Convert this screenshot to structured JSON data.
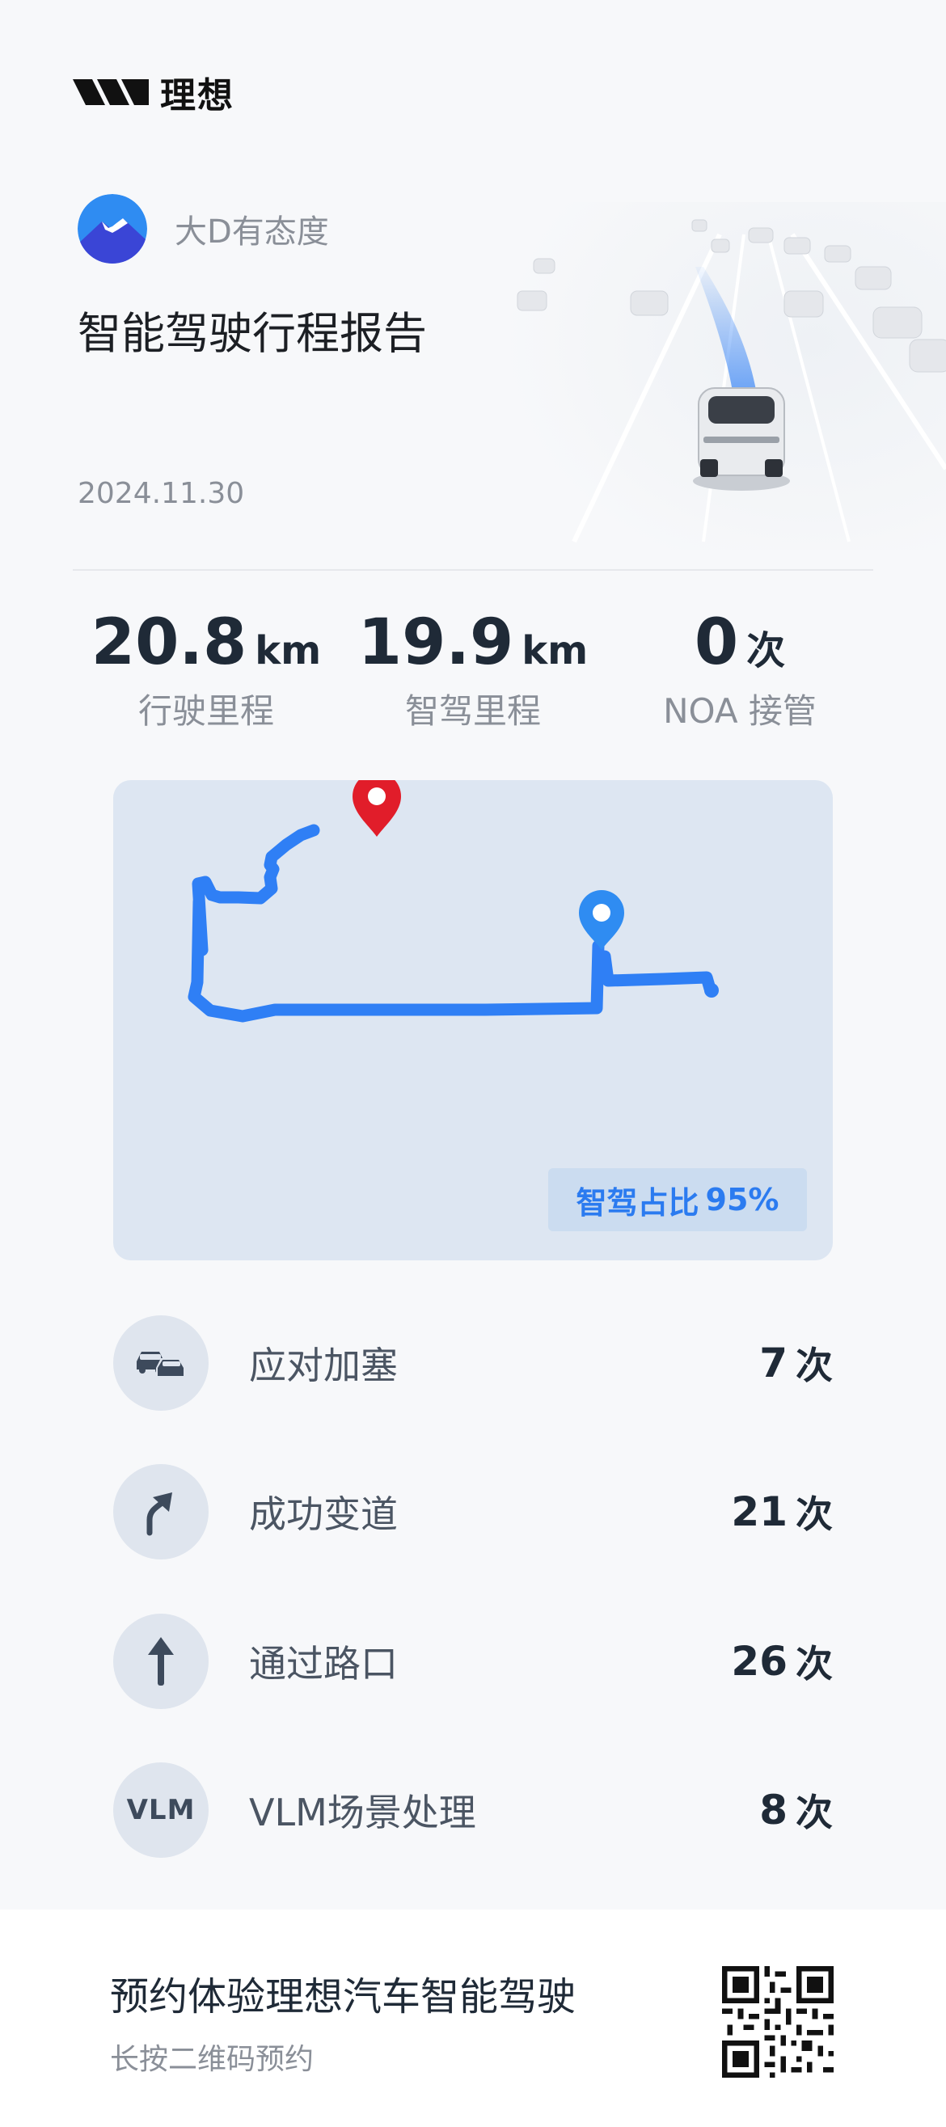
{
  "brand": {
    "name": "理想"
  },
  "user": {
    "name": "大D有态度"
  },
  "report": {
    "title": "智能驾驶行程报告",
    "date": "2024.11.30"
  },
  "stats": [
    {
      "value": "20.8",
      "unit": "km",
      "label": "行驶里程"
    },
    {
      "value": "19.9",
      "unit": "km",
      "label": "智驾里程"
    },
    {
      "value": "0",
      "unit": "次",
      "label": "NOA 接管"
    }
  ],
  "map": {
    "ratio_label": "智驾占比",
    "ratio_value": "95%",
    "route_color": "#2f7ff5",
    "end_pin_color": "#e11d2a",
    "start_pin_color": "#2f8cf2"
  },
  "metrics": [
    {
      "icon": "traffic-jam-icon",
      "label": "应对加塞",
      "value": "7",
      "unit": "次"
    },
    {
      "icon": "lane-change-icon",
      "label": "成功变道",
      "value": "21",
      "unit": "次"
    },
    {
      "icon": "straight-arrow-icon",
      "label": "通过路口",
      "value": "26",
      "unit": "次"
    },
    {
      "icon": "vlm-icon",
      "icon_text": "VLM",
      "label": "VLM场景处理",
      "value": "8",
      "unit": "次"
    }
  ],
  "footer": {
    "title": "预约体验理想汽车智能驾驶",
    "subtitle": "长按二维码预约"
  }
}
